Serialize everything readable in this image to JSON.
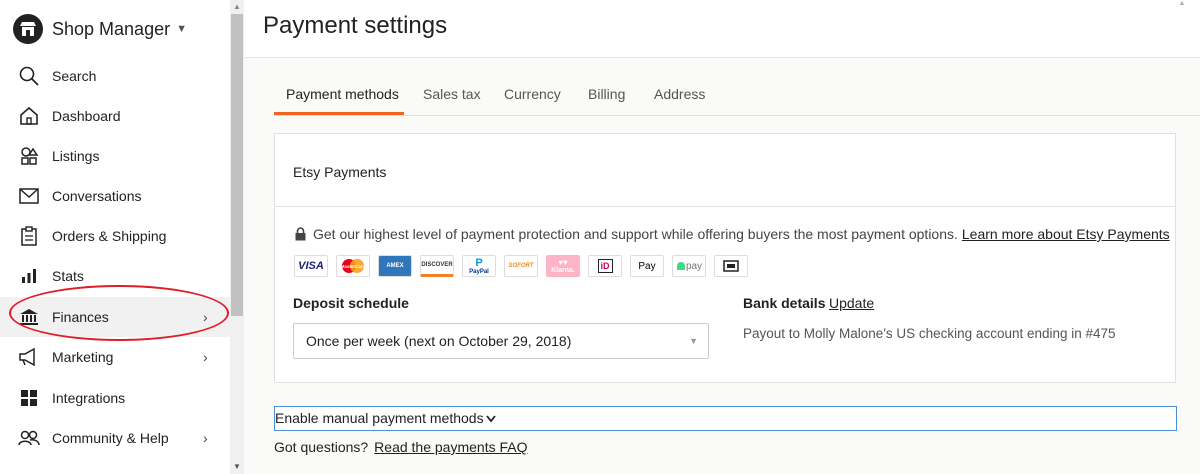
{
  "sidebar": {
    "brand": "Shop Manager",
    "items": [
      {
        "label": "Search",
        "icon": "search-icon"
      },
      {
        "label": "Dashboard",
        "icon": "home-icon"
      },
      {
        "label": "Listings",
        "icon": "shapes-icon"
      },
      {
        "label": "Conversations",
        "icon": "mail-icon"
      },
      {
        "label": "Orders & Shipping",
        "icon": "clipboard-icon"
      },
      {
        "label": "Stats",
        "icon": "bar-chart-icon"
      },
      {
        "label": "Finances",
        "icon": "bank-icon",
        "active": true
      },
      {
        "label": "Marketing",
        "icon": "megaphone-icon"
      },
      {
        "label": "Integrations",
        "icon": "grid-icon"
      },
      {
        "label": "Community & Help",
        "icon": "people-icon"
      }
    ]
  },
  "page": {
    "title": "Payment settings"
  },
  "tabs": [
    {
      "label": "Payment methods",
      "active": true
    },
    {
      "label": "Sales tax"
    },
    {
      "label": "Currency"
    },
    {
      "label": "Billing"
    },
    {
      "label": "Address"
    }
  ],
  "etsy_payments": {
    "title": "Etsy Payments",
    "protection_text": "Get our highest level of payment protection and support while offering buyers the most payment options.",
    "learn_more": "Learn more about Etsy Payments",
    "payment_icons": [
      {
        "name": "visa-icon",
        "text": "VISA",
        "color": "#1a1f71"
      },
      {
        "name": "mastercard-icon",
        "text": "MasterCard",
        "color": "#eb001b"
      },
      {
        "name": "amex-icon",
        "text": "AMEX",
        "color": "#2e77bb"
      },
      {
        "name": "discover-icon",
        "text": "DISCOVER",
        "color": "#333333"
      },
      {
        "name": "paypal-icon",
        "text": "PayPal",
        "color": "#003087"
      },
      {
        "name": "sofort-icon",
        "text": "SOFORT",
        "color": "#ef8a1f"
      },
      {
        "name": "klarna-icon",
        "text": "Klarna.",
        "color": "#ffb3c7"
      },
      {
        "name": "ideal-icon",
        "text": "iD",
        "color": "#cc0066"
      },
      {
        "name": "apple-pay-icon",
        "text": "Pay",
        "color": "#000000"
      },
      {
        "name": "android-pay-icon",
        "text": "pay",
        "color": "#3ddc84"
      },
      {
        "name": "etsy-gift-card-icon",
        "text": "",
        "color": "#222222"
      }
    ],
    "deposit_label": "Deposit schedule",
    "deposit_value": "Once per week (next on October 29, 2018)",
    "bank_label": "Bank details",
    "bank_update": "Update",
    "payout_text": "Payout to Molly Malone's US checking account ending in #475"
  },
  "manual": {
    "label": "Enable manual payment methods"
  },
  "faq": {
    "question": "Got questions?",
    "link": "Read the payments FAQ"
  },
  "colors": {
    "accent": "#f1641e",
    "annotation": "#e01d2a",
    "focus": "#4b8fd9"
  }
}
